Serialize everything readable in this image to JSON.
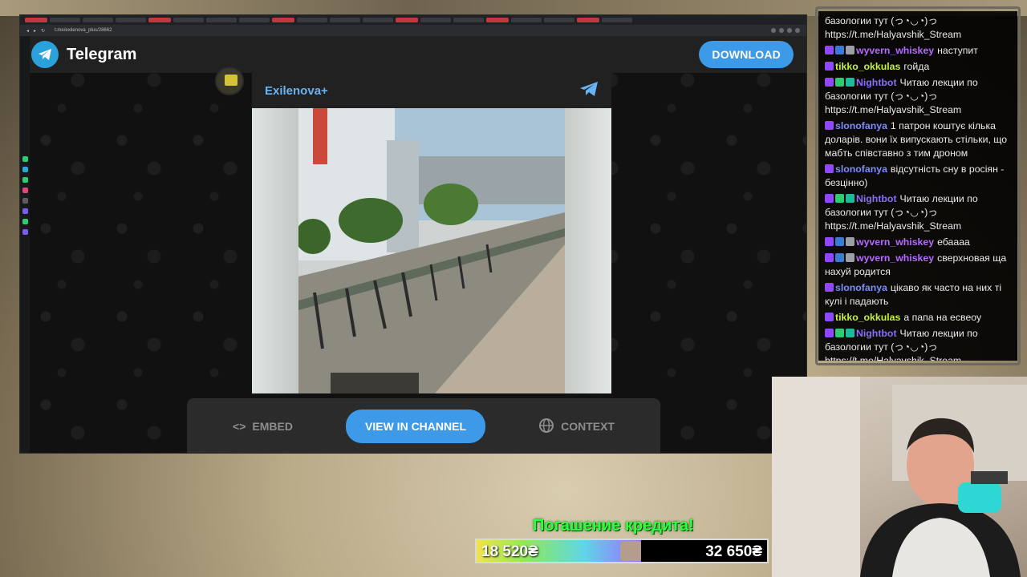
{
  "browser": {
    "address": "t.me/exilenova_plus/28662"
  },
  "telegram": {
    "app_title": "Telegram",
    "download_label": "DOWNLOAD",
    "channel_name": "Exilenova+",
    "actions": {
      "embed_label": "EMBED",
      "view_label": "VIEW IN CHANNEL",
      "context_label": "CONTEXT"
    }
  },
  "chat": {
    "messages": [
      {
        "user": "",
        "text": "базологии тут (っ◔◡◔)っ https://t.me/Halyavshik_Stream"
      },
      {
        "user": "wyvern_whiskey",
        "color": "#b36bff",
        "badges": [
          "b-purple",
          "b-blue",
          "b-gray"
        ],
        "text": "наступит"
      },
      {
        "user": "tikko_okkulas",
        "color": "#c6f23c",
        "badges": [
          "b-purple"
        ],
        "text": "гойда"
      },
      {
        "user": "Nightbot",
        "color": "#8a6cff",
        "badges": [
          "b-purple",
          "b-green",
          "b-teal"
        ],
        "text": "Читаю лекции по базологии тут (っ◔◡◔)っ https://t.me/Halyavshik_Stream"
      },
      {
        "user": "slonofanya",
        "color": "#7d8cff",
        "badges": [
          "b-purple"
        ],
        "text": "1 патрон коштує кілька доларів. вони їх випускають стільки, що мабть співставно з тим дроном"
      },
      {
        "user": "slonofanya",
        "color": "#7d8cff",
        "badges": [
          "b-purple"
        ],
        "text": "відсутність сну в росіян - безцінно)"
      },
      {
        "user": "Nightbot",
        "color": "#8a6cff",
        "badges": [
          "b-purple",
          "b-green",
          "b-teal"
        ],
        "text": "Читаю лекции по базологии тут (っ◔◡◔)っ https://t.me/Halyavshik_Stream"
      },
      {
        "user": "wyvern_whiskey",
        "color": "#b36bff",
        "badges": [
          "b-purple",
          "b-blue",
          "b-gray"
        ],
        "text": "ебаааа"
      },
      {
        "user": "wyvern_whiskey",
        "color": "#b36bff",
        "badges": [
          "b-purple",
          "b-blue",
          "b-gray"
        ],
        "text": "сверхновая ща нахуй родится"
      },
      {
        "user": "slonofanya",
        "color": "#7d8cff",
        "badges": [
          "b-purple"
        ],
        "text": "цікаво як часто на них ті кулі і падають"
      },
      {
        "user": "tikko_okkulas",
        "color": "#c6f23c",
        "badges": [
          "b-purple"
        ],
        "text": "а папа на есвеоу"
      },
      {
        "user": "Nightbot",
        "color": "#8a6cff",
        "badges": [
          "b-purple",
          "b-green",
          "b-teal"
        ],
        "text": "Читаю лекции по базологии тут (っ◔◡◔)っ https://t.me/Halyavshik_Stream"
      }
    ]
  },
  "credit": {
    "title": "Погашение кредита!",
    "current": "18 520₴",
    "goal": "32 650₴",
    "progress": 0.567
  }
}
